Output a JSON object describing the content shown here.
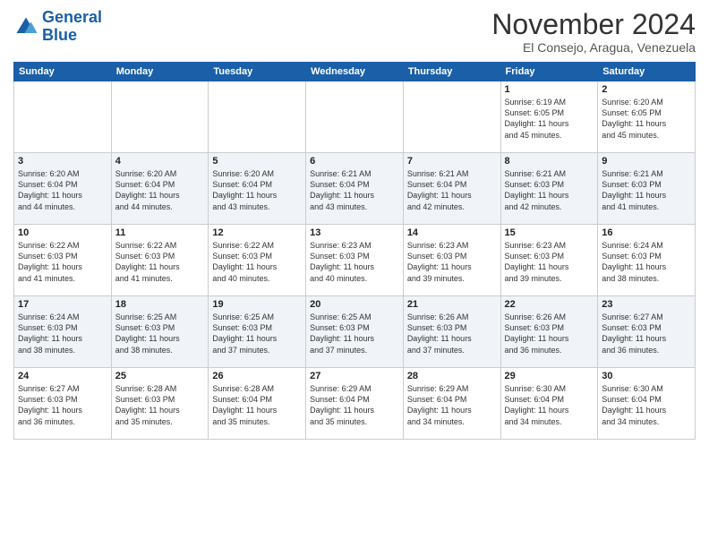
{
  "logo": {
    "line1": "General",
    "line2": "Blue"
  },
  "header": {
    "month": "November 2024",
    "location": "El Consejo, Aragua, Venezuela"
  },
  "weekdays": [
    "Sunday",
    "Monday",
    "Tuesday",
    "Wednesday",
    "Thursday",
    "Friday",
    "Saturday"
  ],
  "weeks": [
    [
      {
        "day": "",
        "info": ""
      },
      {
        "day": "",
        "info": ""
      },
      {
        "day": "",
        "info": ""
      },
      {
        "day": "",
        "info": ""
      },
      {
        "day": "",
        "info": ""
      },
      {
        "day": "1",
        "info": "Sunrise: 6:19 AM\nSunset: 6:05 PM\nDaylight: 11 hours\nand 45 minutes."
      },
      {
        "day": "2",
        "info": "Sunrise: 6:20 AM\nSunset: 6:05 PM\nDaylight: 11 hours\nand 45 minutes."
      }
    ],
    [
      {
        "day": "3",
        "info": "Sunrise: 6:20 AM\nSunset: 6:04 PM\nDaylight: 11 hours\nand 44 minutes."
      },
      {
        "day": "4",
        "info": "Sunrise: 6:20 AM\nSunset: 6:04 PM\nDaylight: 11 hours\nand 44 minutes."
      },
      {
        "day": "5",
        "info": "Sunrise: 6:20 AM\nSunset: 6:04 PM\nDaylight: 11 hours\nand 43 minutes."
      },
      {
        "day": "6",
        "info": "Sunrise: 6:21 AM\nSunset: 6:04 PM\nDaylight: 11 hours\nand 43 minutes."
      },
      {
        "day": "7",
        "info": "Sunrise: 6:21 AM\nSunset: 6:04 PM\nDaylight: 11 hours\nand 42 minutes."
      },
      {
        "day": "8",
        "info": "Sunrise: 6:21 AM\nSunset: 6:03 PM\nDaylight: 11 hours\nand 42 minutes."
      },
      {
        "day": "9",
        "info": "Sunrise: 6:21 AM\nSunset: 6:03 PM\nDaylight: 11 hours\nand 41 minutes."
      }
    ],
    [
      {
        "day": "10",
        "info": "Sunrise: 6:22 AM\nSunset: 6:03 PM\nDaylight: 11 hours\nand 41 minutes."
      },
      {
        "day": "11",
        "info": "Sunrise: 6:22 AM\nSunset: 6:03 PM\nDaylight: 11 hours\nand 41 minutes."
      },
      {
        "day": "12",
        "info": "Sunrise: 6:22 AM\nSunset: 6:03 PM\nDaylight: 11 hours\nand 40 minutes."
      },
      {
        "day": "13",
        "info": "Sunrise: 6:23 AM\nSunset: 6:03 PM\nDaylight: 11 hours\nand 40 minutes."
      },
      {
        "day": "14",
        "info": "Sunrise: 6:23 AM\nSunset: 6:03 PM\nDaylight: 11 hours\nand 39 minutes."
      },
      {
        "day": "15",
        "info": "Sunrise: 6:23 AM\nSunset: 6:03 PM\nDaylight: 11 hours\nand 39 minutes."
      },
      {
        "day": "16",
        "info": "Sunrise: 6:24 AM\nSunset: 6:03 PM\nDaylight: 11 hours\nand 38 minutes."
      }
    ],
    [
      {
        "day": "17",
        "info": "Sunrise: 6:24 AM\nSunset: 6:03 PM\nDaylight: 11 hours\nand 38 minutes."
      },
      {
        "day": "18",
        "info": "Sunrise: 6:25 AM\nSunset: 6:03 PM\nDaylight: 11 hours\nand 38 minutes."
      },
      {
        "day": "19",
        "info": "Sunrise: 6:25 AM\nSunset: 6:03 PM\nDaylight: 11 hours\nand 37 minutes."
      },
      {
        "day": "20",
        "info": "Sunrise: 6:25 AM\nSunset: 6:03 PM\nDaylight: 11 hours\nand 37 minutes."
      },
      {
        "day": "21",
        "info": "Sunrise: 6:26 AM\nSunset: 6:03 PM\nDaylight: 11 hours\nand 37 minutes."
      },
      {
        "day": "22",
        "info": "Sunrise: 6:26 AM\nSunset: 6:03 PM\nDaylight: 11 hours\nand 36 minutes."
      },
      {
        "day": "23",
        "info": "Sunrise: 6:27 AM\nSunset: 6:03 PM\nDaylight: 11 hours\nand 36 minutes."
      }
    ],
    [
      {
        "day": "24",
        "info": "Sunrise: 6:27 AM\nSunset: 6:03 PM\nDaylight: 11 hours\nand 36 minutes."
      },
      {
        "day": "25",
        "info": "Sunrise: 6:28 AM\nSunset: 6:03 PM\nDaylight: 11 hours\nand 35 minutes."
      },
      {
        "day": "26",
        "info": "Sunrise: 6:28 AM\nSunset: 6:04 PM\nDaylight: 11 hours\nand 35 minutes."
      },
      {
        "day": "27",
        "info": "Sunrise: 6:29 AM\nSunset: 6:04 PM\nDaylight: 11 hours\nand 35 minutes."
      },
      {
        "day": "28",
        "info": "Sunrise: 6:29 AM\nSunset: 6:04 PM\nDaylight: 11 hours\nand 34 minutes."
      },
      {
        "day": "29",
        "info": "Sunrise: 6:30 AM\nSunset: 6:04 PM\nDaylight: 11 hours\nand 34 minutes."
      },
      {
        "day": "30",
        "info": "Sunrise: 6:30 AM\nSunset: 6:04 PM\nDaylight: 11 hours\nand 34 minutes."
      }
    ]
  ]
}
